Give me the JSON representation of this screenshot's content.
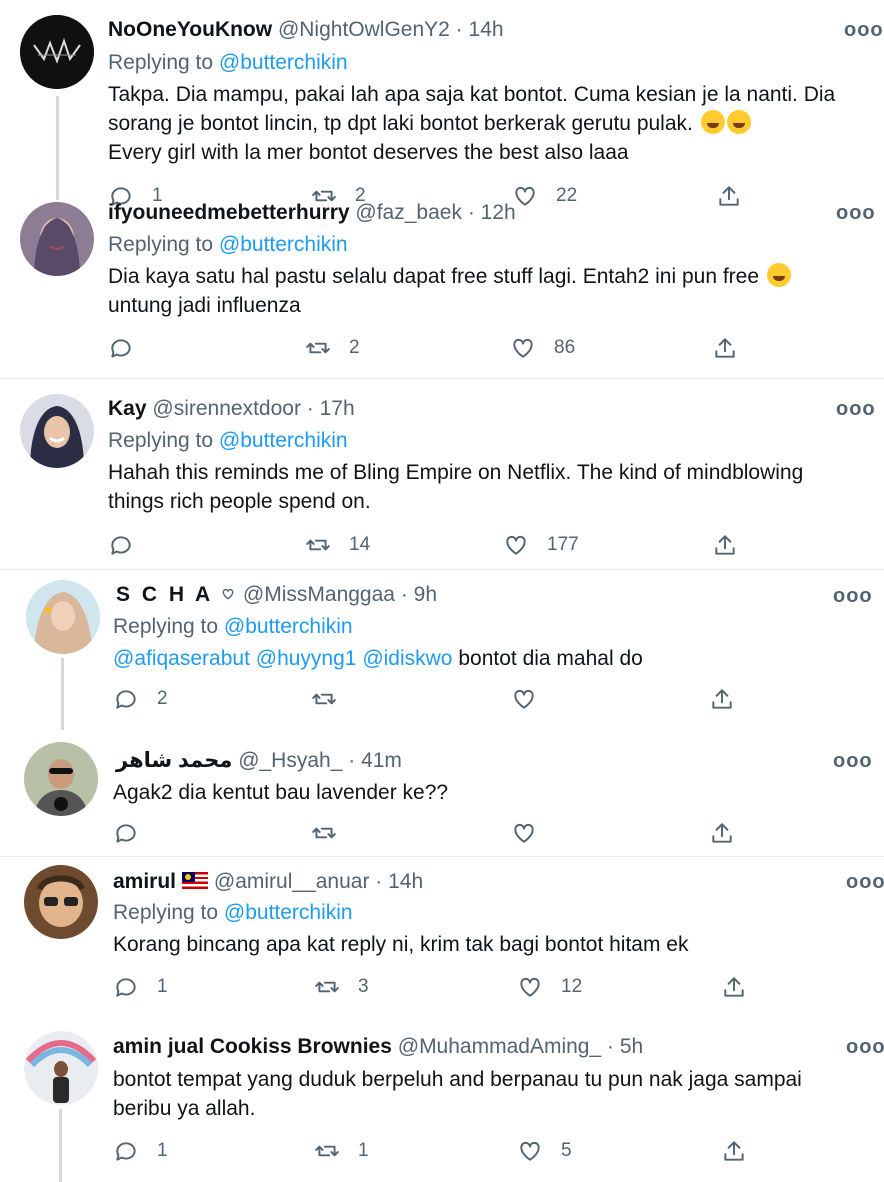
{
  "tweets": [
    {
      "name": "NoOneYouKnow",
      "handle": "@NightOwlGenY2",
      "time": "14h",
      "replying_label": "Replying to",
      "replying_to": "@butterchikin",
      "text_lines": [
        "Takpa. Dia mampu, pakai lah apa saja kat bontot. Cuma kesian je la nanti. Dia",
        "sorang je bontot lincin, tp dpt laki bontot berkerak gerutu pulak.",
        "Every girl with la mer bontot deserves the best also laaa"
      ],
      "emoji": [
        "rolling-on-floor-laughing-emoji",
        "rolling-on-floor-laughing-emoji"
      ],
      "replies": "1",
      "retweets": "2",
      "likes": "22",
      "avatar_color": "#111111"
    },
    {
      "name": "ifyouneedmebetterhurry",
      "handle": "@faz_baek",
      "time": "12h",
      "replying_label": "Replying to",
      "replying_to": "@butterchikin",
      "text_lines": [
        "Dia kaya satu hal pastu selalu dapat free stuff lagi. Entah2 ini pun free",
        "untung jadi influenza"
      ],
      "emoji": [
        "loudly-crying-emoji"
      ],
      "replies": "",
      "retweets": "2",
      "likes": "86",
      "avatar_color": "#6b5a7a"
    },
    {
      "name": "Kay",
      "handle": "@sirennextdoor",
      "time": "17h",
      "replying_label": "Replying to",
      "replying_to": "@butterchikin",
      "text_lines": [
        "Hahah this reminds me of Bling Empire on Netflix. The kind of mindblowing",
        "things rich people spend on."
      ],
      "replies": "",
      "retweets": "14",
      "likes": "177",
      "avatar_color": "#2b2d44"
    },
    {
      "name": "S C H A",
      "name_icon": "heart-outline-icon",
      "handle": "@MissManggaa",
      "time": "9h",
      "replying_label": "Replying to",
      "replying_to": "@butterchikin",
      "mentions": [
        "@afiqaserabut",
        "@huyyng1",
        "@idiskwo"
      ],
      "text": "bontot dia mahal do",
      "replies": "2",
      "retweets": "",
      "likes": "",
      "avatar_color": "#d8b79a"
    },
    {
      "name": "محمد شاهر",
      "handle": "@_Hsyah_",
      "time": "41m",
      "text": "Agak2 dia kentut bau lavender ke??",
      "replies": "",
      "retweets": "",
      "likes": "",
      "avatar_color": "#8b8f7a"
    },
    {
      "name": "amirul",
      "name_icon": "malaysia-flag-icon",
      "handle": "@amirul__anuar",
      "time": "14h",
      "replying_label": "Replying to",
      "replying_to": "@butterchikin",
      "text": "Korang bincang apa kat reply ni, krim tak bagi bontot hitam ek",
      "replies": "1",
      "retweets": "3",
      "likes": "12",
      "avatar_color": "#6e4a2e"
    },
    {
      "name": "amin jual Cookiss Brownies",
      "handle": "@MuhammadAming_",
      "time": "5h",
      "text_lines": [
        "bontot tempat yang duduk berpeluh and berpanau tu pun nak jaga sampai",
        "beribu ya allah."
      ],
      "replies": "1",
      "retweets": "1",
      "likes": "5",
      "avatar_color": "#7aa7c9"
    }
  ],
  "separator": "·",
  "more_glyph": "ooo",
  "colors": {
    "link": "#1d9bf0",
    "muted": "#536471",
    "text": "#0f1419"
  }
}
